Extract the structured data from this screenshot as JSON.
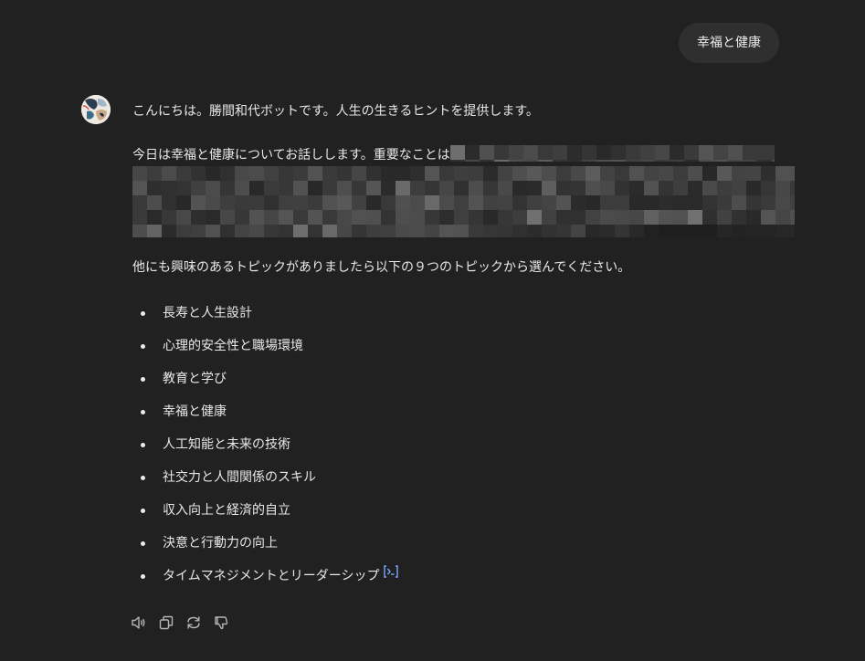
{
  "user_message": {
    "text": "幸福と健康"
  },
  "assistant_message": {
    "greeting": "こんにちは。勝間和代ボットです。人生の生きるヒントを提供します。",
    "intro": "今日は幸福と健康についてお話しします。重要なことは",
    "other_topics": "他にも興味のあるトピックがありましたら以下の９つのトピックから選んでください。",
    "topics": [
      "長寿と人生設計",
      "心理的安全性と職場環境",
      "教育と学び",
      "幸福と健康",
      "人工知能と未来の技術",
      "社交力と人間関係のスキル",
      "収入向上と経済的自立",
      "決意と行動力の向上",
      "タイムマネジメントとリーダーシップ"
    ]
  },
  "actions": [
    {
      "name": "read-aloud",
      "icon": "speaker-icon"
    },
    {
      "name": "copy",
      "icon": "copy-icon"
    },
    {
      "name": "regenerate",
      "icon": "refresh-icon"
    },
    {
      "name": "bad-response",
      "icon": "thumbs-down-icon"
    }
  ],
  "colors": {
    "background": "#212121",
    "user_bubble": "#2f2f2f",
    "text": "#ececec",
    "citation": "#7aa7ff",
    "icon": "#b4b4b4"
  }
}
